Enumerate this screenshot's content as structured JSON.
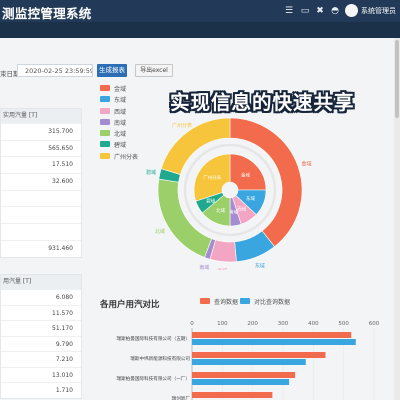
{
  "header": {
    "title": "测监控管理系统",
    "user_name": "系统管理员",
    "icons": [
      "menu-icon",
      "monitor-icon",
      "tools-icon",
      "dashboard-icon",
      "user-avatar-icon"
    ]
  },
  "filter": {
    "label": "束日期",
    "date_value": "2020-02-25 23:59:59",
    "generate_label": "生成报表",
    "export_label": "导出excel"
  },
  "table1": {
    "header": "实用汽量 [T]",
    "values": [
      "315.700",
      "565.650",
      "17.510",
      "32.600",
      "",
      "",
      "",
      "931.460"
    ]
  },
  "table2": {
    "header": "用汽量 [T]",
    "values": [
      "6.080",
      "11.570",
      "51.170",
      "9.790",
      "7.210",
      "13.010",
      "1.710"
    ]
  },
  "banner": "实现信息的快速共享",
  "chart_data": [
    {
      "type": "pie",
      "subtype": "nested-donut",
      "legend": [
        "金域",
        "东域",
        "西域",
        "南域",
        "北域",
        "碧域",
        "广州分表"
      ],
      "colors": [
        "#f26b4c",
        "#3aa6e0",
        "#f3a6c4",
        "#a58bd0",
        "#9bcf6a",
        "#1fa98f",
        "#f7c53c"
      ],
      "outer": {
        "labels": [
          "金域",
          "东域",
          "西域",
          "南域",
          "北域",
          "碧域",
          "广州分表"
        ],
        "values": [
          315.7,
          73.5,
          47.4,
          10.1,
          173.6,
          19.0,
          161.9
        ]
      },
      "inner": {
        "labels": [
          "金域",
          "东域",
          "西域",
          "南域",
          "北域",
          "碧域",
          "广州分表"
        ],
        "values": [
          25,
          12,
          8,
          5,
          14,
          6,
          30
        ]
      }
    },
    {
      "type": "bar",
      "orientation": "horizontal",
      "title": "各用户用汽对比",
      "categories": [
        "瑞斯柏曼国际科技有限公司（五期）",
        "瑞斯中纬新能源科技有限公司",
        "瑞斯柏曼国际科技有限公司（一厂）",
        "瑞创新厂"
      ],
      "series": [
        {
          "name": "查询数据",
          "color": "#f26b4c",
          "values": [
            525,
            440,
            340,
            265
          ]
        },
        {
          "name": "对比查询数据",
          "color": "#3aa6e0",
          "values": [
            540,
            375,
            320,
            0
          ]
        }
      ],
      "xlim": [
        0,
        600
      ],
      "xticks": [
        0,
        100,
        200,
        300,
        400,
        500,
        600
      ]
    }
  ]
}
